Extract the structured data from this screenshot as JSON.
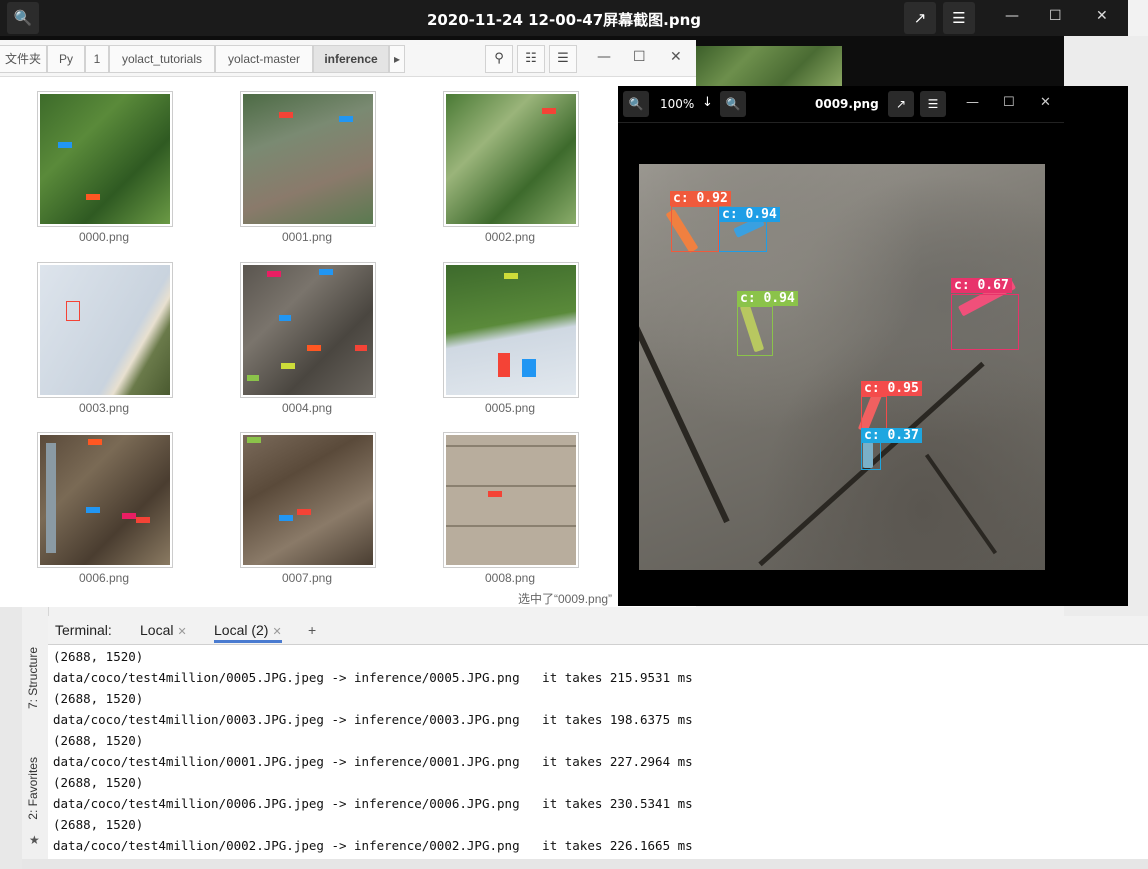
{
  "outer": {
    "title": "2020-11-24 12-00-47屏幕截图.png",
    "zoom_icon": "search-icon",
    "expand_icon": "expand-icon",
    "menu_icon": "hamburger-menu-icon"
  },
  "file_manager": {
    "breadcrumbs": [
      "文件夹",
      "Py",
      "1",
      "yolact_tutorials",
      "yolact-master",
      "inference"
    ],
    "status": "选中了“0009.png”",
    "files": [
      "0000.png",
      "0001.png",
      "0002.png",
      "0003.png",
      "0004.png",
      "0005.png",
      "0006.png",
      "0007.png",
      "0008.png"
    ]
  },
  "viewer": {
    "title": "0009.png",
    "zoom": "100%",
    "detections": [
      {
        "label": "c: 0.92",
        "color": "#f05a3c"
      },
      {
        "label": "c: 0.94",
        "color": "#1e9ee6"
      },
      {
        "label": "c: 0.94",
        "color": "#8bc34a"
      },
      {
        "label": "c: 0.67",
        "color": "#e8336b"
      },
      {
        "label": "c: 0.95",
        "color": "#f44b4b"
      },
      {
        "label": "c: 0.37",
        "color": "#1ea6e0"
      }
    ]
  },
  "sidebar": {
    "structure": "7: Structure",
    "favorites": "2: Favorites"
  },
  "terminal": {
    "label": "Terminal:",
    "tabs": [
      "Local",
      "Local (2)"
    ],
    "add": "+",
    "lines": [
      "(2688, 1520)",
      "data/coco/test4million/0005.JPG.jpeg -> inference/0005.JPG.png   it takes 215.9531 ms",
      "(2688, 1520)",
      "data/coco/test4million/0003.JPG.jpeg -> inference/0003.JPG.png   it takes 198.6375 ms",
      "(2688, 1520)",
      "data/coco/test4million/0001.JPG.jpeg -> inference/0001.JPG.png   it takes 227.2964 ms",
      "(2688, 1520)",
      "data/coco/test4million/0006.JPG.jpeg -> inference/0006.JPG.png   it takes 230.5341 ms",
      "(2688, 1520)",
      "data/coco/test4million/0002.JPG.jpeg -> inference/0002.JPG.png   it takes 226.1665 ms"
    ]
  }
}
